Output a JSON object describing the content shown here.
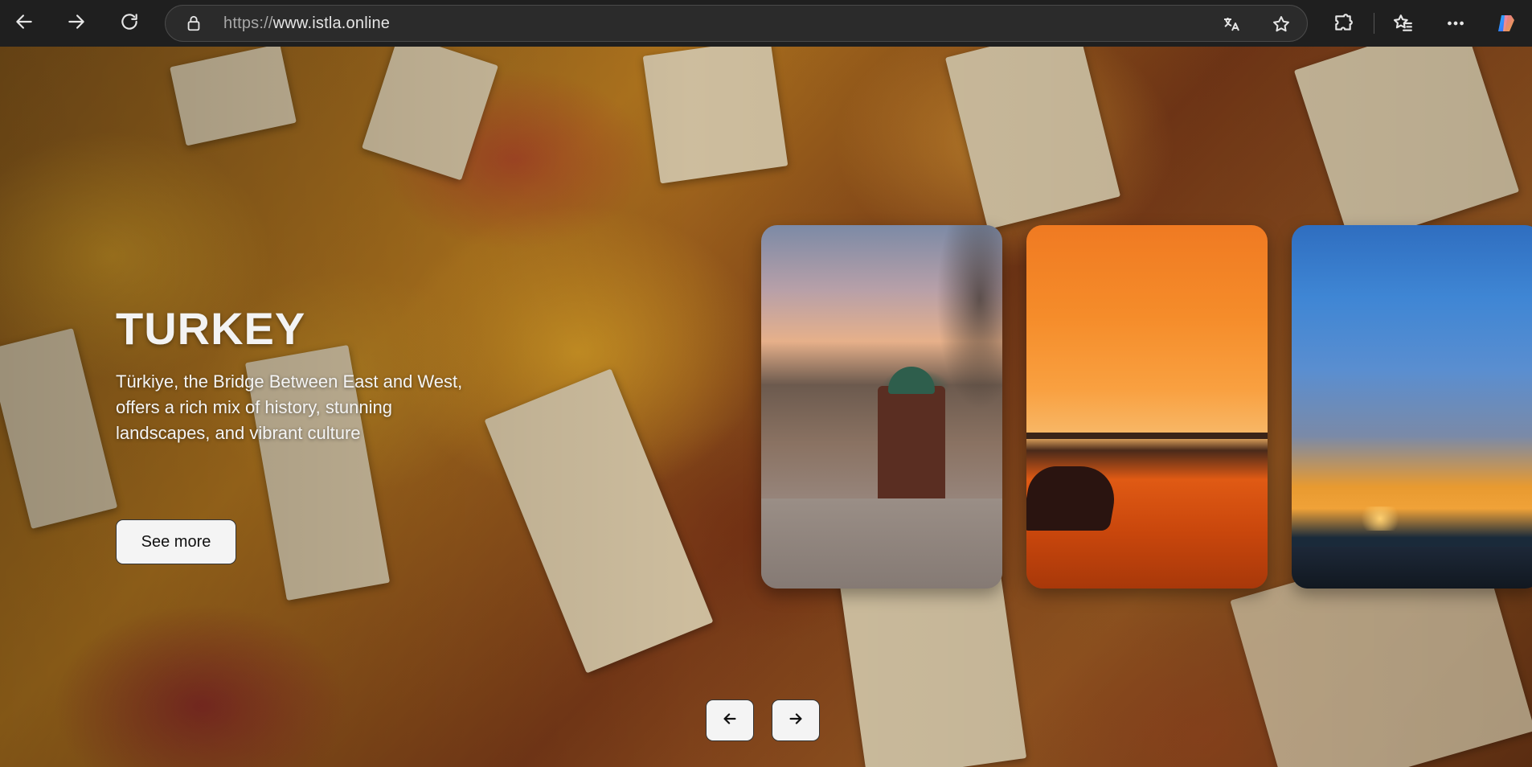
{
  "browser": {
    "url_scheme": "https://",
    "url_host": "www.istla.online",
    "icons": {
      "back": "back-arrow-icon",
      "forward": "forward-arrow-icon",
      "refresh": "refresh-icon",
      "lock": "lock-icon",
      "translate": "translate-icon",
      "favorite": "star-icon",
      "extensions": "puzzle-icon",
      "favorites": "favorites-icon",
      "more": "more-dots-icon",
      "copilot": "copilot-icon"
    }
  },
  "hero": {
    "title": "TURKEY",
    "description": "Türkiye, the Bridge Between East and West, offers a rich mix of history, stunning landscapes, and vibrant culture",
    "cta_label": "See more",
    "background_image": "spice-market-photo"
  },
  "carousel": {
    "cards": [
      {
        "image": "sarajevo-sebilj-fountain-square-photo"
      },
      {
        "image": "orange-sunset-beach-horse-photo"
      },
      {
        "image": "blue-sky-sunset-boats-photo"
      }
    ],
    "prev_icon": "arrow-left-icon",
    "next_icon": "arrow-right-icon"
  },
  "colors": {
    "browser_bg": "#1f1f1f",
    "urlbar_bg": "#2b2b2b",
    "button_bg": "#f4f4f4",
    "title_text": "#f3f3f3"
  }
}
